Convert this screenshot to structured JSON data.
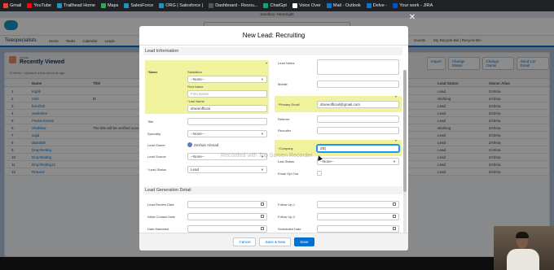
{
  "bookmarks": [
    {
      "label": "Gmail",
      "color": "#ea4335"
    },
    {
      "label": "YouTube",
      "color": "#ff0000"
    },
    {
      "label": "Trailhead Home",
      "color": "#1798c1"
    },
    {
      "label": "Maps",
      "color": "#34a853"
    },
    {
      "label": "SalesForce",
      "color": "#1798c1"
    },
    {
      "label": "ORG | Salesforce |",
      "color": "#1798c1"
    },
    {
      "label": "Dashboard - Resou...",
      "color": "#555555"
    },
    {
      "label": "ChatGpt",
      "color": "#10a37f"
    },
    {
      "label": "Voice Over",
      "color": "#ffffff"
    },
    {
      "label": "Mail - Outlook",
      "color": "#0078d4"
    },
    {
      "label": "Delve -",
      "color": "#0078d4"
    },
    {
      "label": "Your work - JIRA",
      "color": "#0052cc"
    }
  ],
  "sandbox_banner": "Sandbox: HireKnight",
  "nav": {
    "app_name": "Telespecialists",
    "items": [
      "Home",
      "Tasks",
      "Calendar",
      "Leads"
    ],
    "right_items": [
      "Guests",
      "My Recycle Bin | Recycle Bin"
    ]
  },
  "list": {
    "object": "Leads",
    "view": "Recently Viewed",
    "meta": "12 items • Updated a few seconds ago",
    "buttons": [
      "Import",
      "Change Status",
      "Change Owner",
      "Send List Email"
    ],
    "columns": [
      "Name",
      "Title",
      "Lead Status",
      "Owner Alias"
    ],
    "rows": [
      {
        "n": "1",
        "name": "Kighli",
        "title": "",
        "status": "Lead",
        "owner": "ZAhma"
      },
      {
        "n": "2",
        "name": "mmi",
        "title": "ttt",
        "status": "Working",
        "owner": "ZAhma"
      },
      {
        "n": "3",
        "name": "ferrofish",
        "title": "",
        "status": "Lead",
        "owner": "ZAhma"
      },
      {
        "n": "4",
        "name": "washdeor",
        "title": "",
        "status": "Lead",
        "owner": "ZAhma"
      },
      {
        "n": "5",
        "name": "Pasha Kamal",
        "title": "",
        "status": "Lead",
        "owner": "ZAhma"
      },
      {
        "n": "6",
        "name": "Shahbaz",
        "title": "The title will be verified soon",
        "status": "Working",
        "owner": "ZAhma"
      },
      {
        "n": "7",
        "name": "sajid",
        "title": "",
        "status": "Lead",
        "owner": "ZAhma"
      },
      {
        "n": "8",
        "name": "abdullah",
        "title": "",
        "status": "Lead",
        "owner": "ZAhma"
      },
      {
        "n": "9",
        "name": "DrupTesting",
        "title": "",
        "status": "Lead",
        "owner": "ZAhma"
      },
      {
        "n": "10",
        "name": "DrupTesting",
        "title": "",
        "status": "Lead",
        "owner": "ZAhma"
      },
      {
        "n": "11",
        "name": "DrupTesting12",
        "title": "",
        "status": "Lead",
        "owner": "ZAhma"
      },
      {
        "n": "12",
        "name": "Rona12",
        "title": "",
        "status": "Lead",
        "owner": "ZAhma"
      }
    ]
  },
  "modal": {
    "title": "New Lead: Recruiting",
    "sections": {
      "lead_info": "Lead Information",
      "lead_gen": "Lead Generation Detail"
    },
    "left": {
      "name_label": "Name",
      "salutation_label": "Salutation",
      "salutation_value": "--None--",
      "first_name_label": "First Name",
      "first_name_placeholder": "First Name",
      "last_name_label": "Last Name",
      "last_name_value": "drseeofficial",
      "title_label": "Title",
      "specialty_label": "Specialty",
      "specialty_value": "--None--",
      "lead_owner_label": "Lead Owner",
      "lead_owner_value": "Zeshan Ahmad",
      "lead_source_label": "Lead Source",
      "lead_source_value": "--None--",
      "lead_status_label": "Lead Status",
      "lead_status_value": "Lead",
      "review_date_label": "Lead Review Date",
      "initial_contact_label": "Initial Contact Date",
      "date_marketed_label": "Date Marketed"
    },
    "right": {
      "lead_notes_label": "Lead Notes",
      "mobile_label": "Mobile",
      "primary_email_label": "Primary Email",
      "primary_email_value": "drseeofficial@gmail.com",
      "referrer_label": "Referrer",
      "recruiter_label": "Recruiter",
      "company_label": "Company",
      "company_value": "ZB|",
      "last_status_label": "Last Status",
      "last_status_value": "--None--",
      "email_opt_out_label": "Email Opt Out",
      "follow_up_1_label": "Follow Up 1",
      "follow_up_2_label": "Follow Up 2",
      "scheduled_label": "Scheduled Date"
    },
    "footer": {
      "cancel": "Cancel",
      "save_new": "Save & New",
      "save": "Save"
    }
  },
  "watermark": "Recorded with Top Screen Recorder",
  "close_symbol": "✕"
}
